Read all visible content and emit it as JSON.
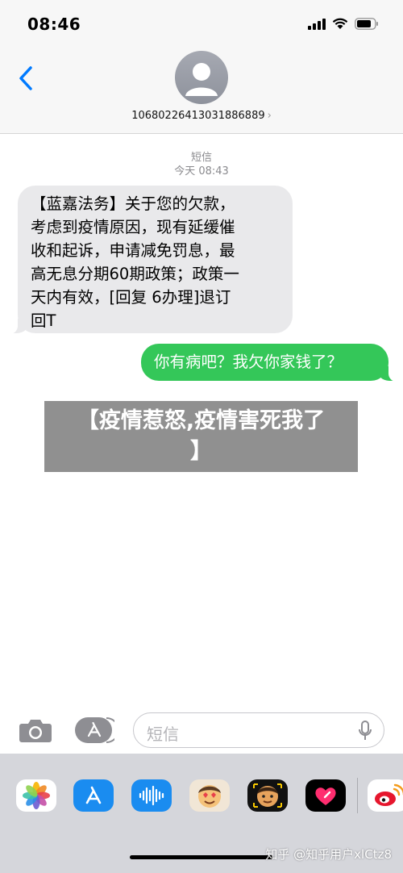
{
  "status_bar": {
    "time": "08:46"
  },
  "header": {
    "sender_number": "10680226413031886889",
    "chevron": "›"
  },
  "thread": {
    "service_label": "短信",
    "timestamp": "今天 08:43"
  },
  "messages": [
    {
      "direction": "incoming",
      "text": "【蓝嘉法务】关于您的欠款，\n考虑到疫情原因，现有延缓催\n收和起诉，申请减免罚息，最\n高无息分期60期政策；政策一\n天内有效，[回复 6办理]退订\n回T"
    },
    {
      "direction": "outgoing",
      "text": "你有病吧？我欠你家钱了？"
    }
  ],
  "overlay_caption": "【疫情惹怒,疫情害死我了\n】",
  "compose": {
    "placeholder": "短信"
  },
  "app_tray": {
    "icons": [
      "photos-icon",
      "app-store-icon",
      "audio-message-icon",
      "memoji-stickers-icon",
      "animoji-icon",
      "digital-touch-icon",
      "weibo-icon"
    ]
  },
  "watermark": "知乎 @知乎用户xlCtz8",
  "colors": {
    "incoming_bubble": "#e9e9eb",
    "outgoing_bubble": "#34c759",
    "accent": "#007aff"
  }
}
